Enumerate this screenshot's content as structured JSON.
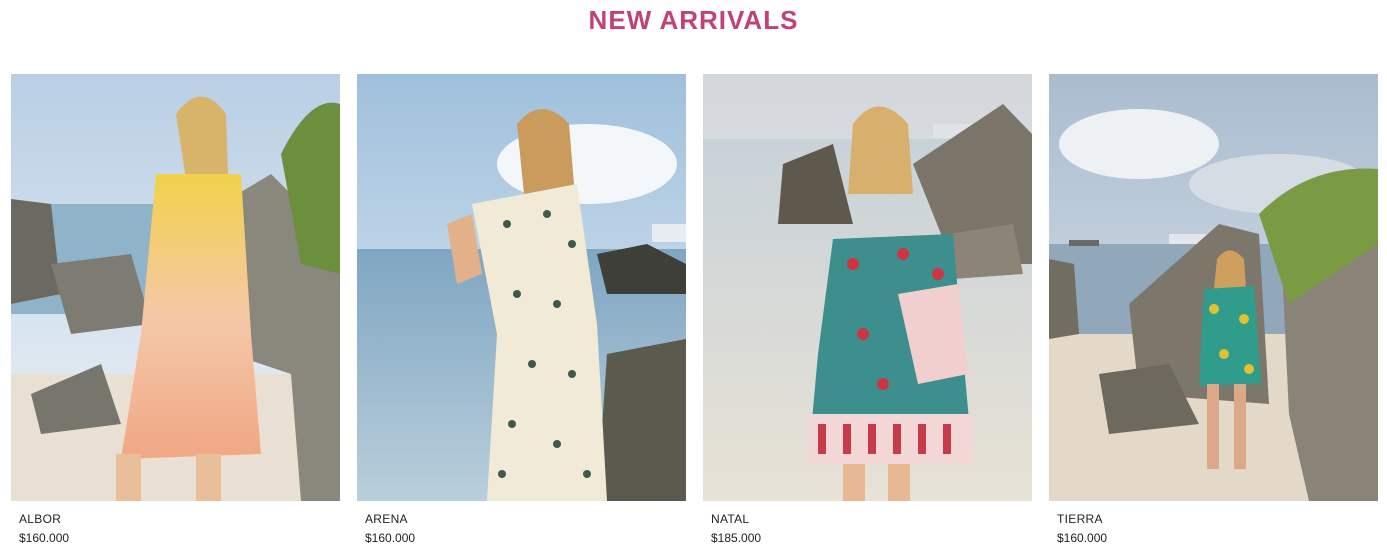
{
  "section": {
    "title": "NEW ARRIVALS"
  },
  "products": [
    {
      "name": "ALBOR",
      "price": "$160.000",
      "image": "woman in yellow-peach tie-dye shirt dress on rocky beach"
    },
    {
      "name": "ARENA",
      "price": "$160.000",
      "image": "woman in cream printed kaftan dress by the sea"
    },
    {
      "name": "NATAL",
      "price": "$185.000",
      "image": "woman in teal floral off-shoulder dress on beach"
    },
    {
      "name": "TIERRA",
      "price": "$160.000",
      "image": "woman in green-yellow print romper among rocks"
    }
  ]
}
